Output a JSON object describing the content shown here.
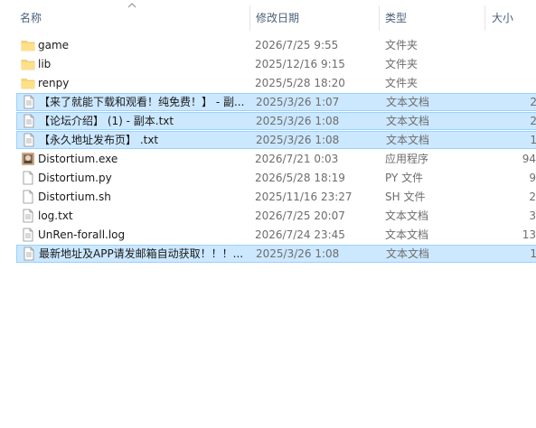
{
  "columns": {
    "name": "名称",
    "date": "修改日期",
    "type": "类型",
    "size": "大小"
  },
  "rows": [
    {
      "name": "game",
      "date": "2026/7/25 9:55",
      "type": "文件夹",
      "size": "",
      "icon": "folder-icon",
      "selected": false
    },
    {
      "name": "lib",
      "date": "2025/12/16 9:15",
      "type": "文件夹",
      "size": "",
      "icon": "folder-icon",
      "selected": false
    },
    {
      "name": "renpy",
      "date": "2025/5/28 18:20",
      "type": "文件夹",
      "size": "",
      "icon": "folder-icon",
      "selected": false
    },
    {
      "name": "【来了就能下载和观看！纯免费！】 - 副...",
      "date": "2025/3/26 1:07",
      "type": "文本文档",
      "size": "2",
      "icon": "text-file-icon",
      "selected": true
    },
    {
      "name": "【论坛介绍】 (1) - 副本.txt",
      "date": "2025/3/26 1:08",
      "type": "文本文档",
      "size": "2",
      "icon": "text-file-icon",
      "selected": true
    },
    {
      "name": "【永久地址发布页】 .txt",
      "date": "2025/3/26 1:08",
      "type": "文本文档",
      "size": "1",
      "icon": "text-file-icon",
      "selected": true
    },
    {
      "name": "Distortium.exe",
      "date": "2026/7/21 0:03",
      "type": "应用程序",
      "size": "94",
      "icon": "application-icon",
      "selected": false
    },
    {
      "name": "Distortium.py",
      "date": "2026/5/28 18:19",
      "type": "PY 文件",
      "size": "9",
      "icon": "blank-file-icon",
      "selected": false
    },
    {
      "name": "Distortium.sh",
      "date": "2025/11/16 23:27",
      "type": "SH 文件",
      "size": "2",
      "icon": "blank-file-icon",
      "selected": false
    },
    {
      "name": "log.txt",
      "date": "2026/7/25 20:07",
      "type": "文本文档",
      "size": "3",
      "icon": "text-file-icon",
      "selected": false
    },
    {
      "name": "UnRen-forall.log",
      "date": "2026/7/24 23:45",
      "type": "文本文档",
      "size": "13",
      "icon": "text-file-icon",
      "selected": false
    },
    {
      "name": "最新地址及APP请发邮箱自动获取！！！...",
      "date": "2025/3/26 1:08",
      "type": "文本文档",
      "size": "1",
      "icon": "text-file-icon",
      "selected": true
    }
  ],
  "colors": {
    "selection_bg": "#cce8ff",
    "selection_border": "#99d1ff",
    "header_text": "#4c607a",
    "secondary_text": "#6d6d6d"
  }
}
